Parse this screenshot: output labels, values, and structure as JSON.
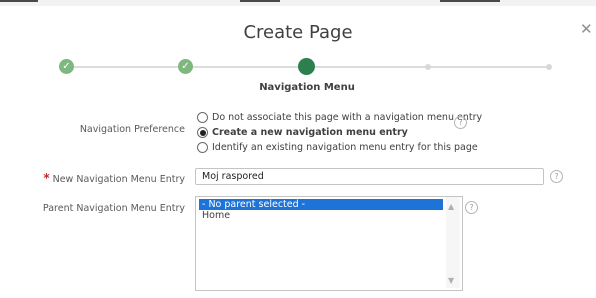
{
  "dialog": {
    "title": "Create Page",
    "close_icon": "close-icon"
  },
  "wizard": {
    "steps": [
      "complete",
      "complete",
      "current",
      "pending",
      "pending"
    ],
    "current_label": "Navigation Menu",
    "completed_mark": "✓"
  },
  "navigation_preference": {
    "label": "Navigation Preference",
    "options": [
      "Do not associate this page with a navigation menu entry",
      "Create a new navigation menu entry",
      "Identify an existing navigation menu entry for this page"
    ],
    "selected_index": 1
  },
  "new_entry": {
    "required_mark": "*",
    "label": "New Navigation Menu Entry",
    "value": "Moj raspored"
  },
  "parent_entry": {
    "label": "Parent Navigation Menu Entry",
    "options": [
      "- No parent selected -",
      "Home"
    ],
    "selected_index": 0
  },
  "help_glyph": "?",
  "scroll_up_glyph": "▲",
  "scroll_down_glyph": "▼",
  "colors": {
    "accent": "#2d7f4f",
    "step_complete": "#7fb87f",
    "selection": "#1e73d8",
    "required": "#c62828"
  }
}
